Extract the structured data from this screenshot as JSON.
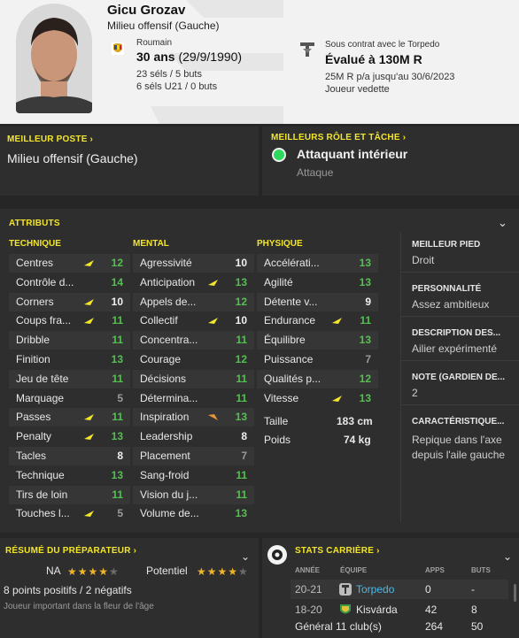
{
  "player": {
    "name": "Gicu Grozav",
    "position": "Milieu offensif (Gauche)",
    "nationality": "Roumain",
    "age": "30 ans",
    "dob": "(29/9/1990)",
    "caps": "23 séls / 5 buts",
    "u21_caps": "6 séls U21 / 0 buts"
  },
  "contract": {
    "status": "Sous contrat avec le Torpedo",
    "value": "Évalué à 130M R",
    "wage": "25M R p/a jusqu'au 30/6/2023",
    "role": "Joueur vedette"
  },
  "best_position": {
    "title": "MEILLEUR POSTE ›",
    "value": "Milieu offensif (Gauche)"
  },
  "roles": {
    "title": "MEILLEURS RÔLE ET TÂCHE ›",
    "role": "Attaquant intérieur",
    "duty": "Attaque"
  },
  "attributes": {
    "title": "ATTRIBUTS",
    "technical_title": "TECHNIQUE",
    "mental_title": "MENTAL",
    "physical_title": "PHYSIQUE",
    "technical": [
      {
        "name": "Centres",
        "value": "12",
        "arrow": "up"
      },
      {
        "name": "Contrôle d...",
        "value": "14",
        "arrow": ""
      },
      {
        "name": "Corners",
        "value": "10",
        "arrow": "up"
      },
      {
        "name": "Coups fra...",
        "value": "11",
        "arrow": "up"
      },
      {
        "name": "Dribble",
        "value": "11",
        "arrow": ""
      },
      {
        "name": "Finition",
        "value": "13",
        "arrow": ""
      },
      {
        "name": "Jeu de tête",
        "value": "11",
        "arrow": ""
      },
      {
        "name": "Marquage",
        "value": "5",
        "arrow": ""
      },
      {
        "name": "Passes",
        "value": "11",
        "arrow": "up"
      },
      {
        "name": "Penalty",
        "value": "13",
        "arrow": "up"
      },
      {
        "name": "Tacles",
        "value": "8",
        "arrow": ""
      },
      {
        "name": "Technique",
        "value": "13",
        "arrow": ""
      },
      {
        "name": "Tirs de loin",
        "value": "11",
        "arrow": ""
      },
      {
        "name": "Touches l...",
        "value": "5",
        "arrow": "up"
      }
    ],
    "mental": [
      {
        "name": "Agressivité",
        "value": "10",
        "arrow": ""
      },
      {
        "name": "Anticipation",
        "value": "13",
        "arrow": "up"
      },
      {
        "name": "Appels de...",
        "value": "12",
        "arrow": ""
      },
      {
        "name": "Collectif",
        "value": "10",
        "arrow": "up"
      },
      {
        "name": "Concentra...",
        "value": "11",
        "arrow": ""
      },
      {
        "name": "Courage",
        "value": "12",
        "arrow": ""
      },
      {
        "name": "Décisions",
        "value": "11",
        "arrow": ""
      },
      {
        "name": "Détermina...",
        "value": "11",
        "arrow": ""
      },
      {
        "name": "Inspiration",
        "value": "13",
        "arrow": "down"
      },
      {
        "name": "Leadership",
        "value": "8",
        "arrow": ""
      },
      {
        "name": "Placement",
        "value": "7",
        "arrow": ""
      },
      {
        "name": "Sang-froid",
        "value": "11",
        "arrow": ""
      },
      {
        "name": "Vision du j...",
        "value": "11",
        "arrow": ""
      },
      {
        "name": "Volume de...",
        "value": "13",
        "arrow": ""
      }
    ],
    "physical": [
      {
        "name": "Accélérati...",
        "value": "13",
        "arrow": ""
      },
      {
        "name": "Agilité",
        "value": "13",
        "arrow": ""
      },
      {
        "name": "Détente v...",
        "value": "9",
        "arrow": ""
      },
      {
        "name": "Endurance",
        "value": "11",
        "arrow": "up"
      },
      {
        "name": "Équilibre",
        "value": "13",
        "arrow": ""
      },
      {
        "name": "Puissance",
        "value": "7",
        "arrow": ""
      },
      {
        "name": "Qualités p...",
        "value": "12",
        "arrow": ""
      },
      {
        "name": "Vitesse",
        "value": "13",
        "arrow": "up"
      }
    ],
    "height_label": "Taille",
    "height": "183 cm",
    "weight_label": "Poids",
    "weight": "74 kg"
  },
  "side": {
    "foot_title": "MEILLEUR PIED",
    "foot": "Droit",
    "pers_title": "PERSONNALITÉ",
    "pers": "Assez ambitieux",
    "desc_title": "DESCRIPTION DES...",
    "desc": "Ailier expérimenté",
    "gk_title": "NOTE (GARDIEN DE...",
    "gk": "2",
    "trait_title": "CARACTÉRISTIQUE...",
    "trait1": "Repique dans l'axe",
    "trait2": "depuis l'aile gauche"
  },
  "coach": {
    "title": "RÉSUMÉ DU PRÉPARATEUR ›",
    "na_label": "NA",
    "na_stars": 4,
    "pot_label": "Potentiel",
    "pot_stars": 4,
    "points": "8 points positifs / 2 négatifs",
    "desc": "Joueur important dans la fleur de l'âge"
  },
  "career": {
    "title": "STATS CARRIÈRE ›",
    "h_year": "ANNÉE",
    "h_team": "ÉQUIPE",
    "h_apps": "APPS",
    "h_goals": "BUTS",
    "rows": [
      {
        "year": "20-21",
        "team": "Torpedo",
        "apps": "0",
        "goals": "-"
      },
      {
        "year": "18-20",
        "team": "Kisvárda",
        "apps": "42",
        "goals": "8"
      }
    ],
    "total_label": "Général 11 club(s)",
    "total_apps": "264",
    "total_goals": "50"
  },
  "colors": {
    "accent": "#f2e52a",
    "good": "#52c24e",
    "star": "#f0b429",
    "role_dot": "#2dd85a"
  }
}
